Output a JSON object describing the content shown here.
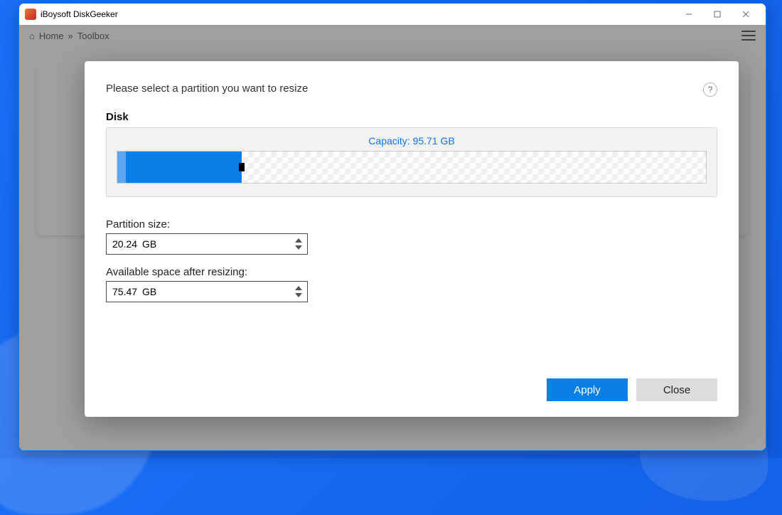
{
  "window": {
    "title": "iBoysoft DiskGeeker"
  },
  "background": {
    "breadcrumb_home": "Home",
    "breadcrumb_separator": "»",
    "breadcrumb_current": "Toolbox"
  },
  "dialog": {
    "instruction": "Please select a partition you want to resize",
    "disk_heading": "Disk",
    "capacity_label": "Capacity: 95.71 GB",
    "disk": {
      "total_gb": 95.71,
      "used_gb": 20.24,
      "used_percent": 21.15
    },
    "partition_size": {
      "label": "Partition size:",
      "value": "20.24",
      "unit": "GB"
    },
    "available_space": {
      "label": "Available space after resizing:",
      "value": "75.47",
      "unit": "GB"
    },
    "apply_label": "Apply",
    "close_label": "Close"
  }
}
